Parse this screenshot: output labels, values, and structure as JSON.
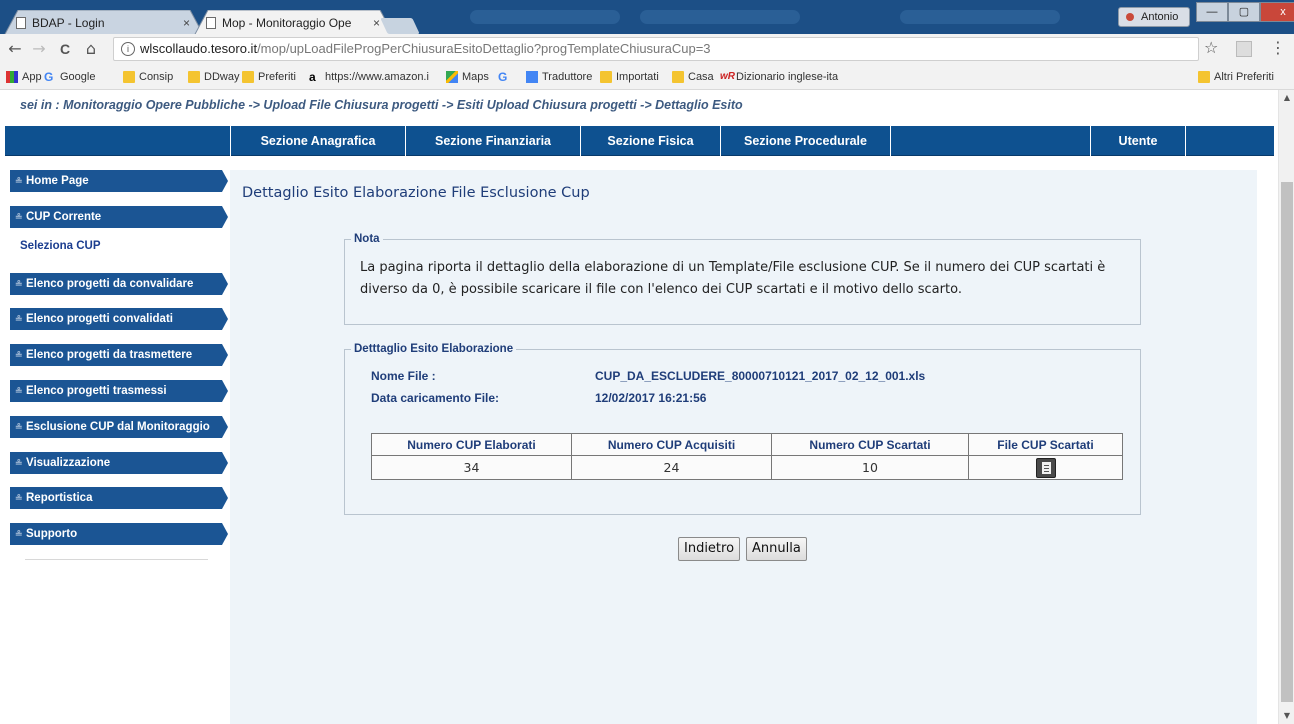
{
  "browser": {
    "tabs": [
      {
        "label": "BDAP - Login",
        "close": "×"
      },
      {
        "label": "Mop - Monitoraggio Ope",
        "close": "×"
      }
    ],
    "user": "Antonio",
    "window_buttons": {
      "minimize": "—",
      "maximize": "▢",
      "close": "x"
    },
    "url_host": "wlscollaudo.tesoro.it",
    "url_path": "/mop/upLoadFileProgPerChiusuraEsitoDettaglio?progTemplateChiusuraCup=3",
    "nav": {
      "back": "←",
      "forward": "→",
      "reload": "C",
      "home": "⌂",
      "info": "i",
      "star": "☆",
      "menu": "⋮"
    },
    "bookmarks": [
      {
        "label": "App",
        "icon": "apps-icon"
      },
      {
        "label": "Google",
        "icon": "google-icon"
      },
      {
        "label": "Consip",
        "icon": "folder-icon"
      },
      {
        "label": "DDway",
        "icon": "folder-icon"
      },
      {
        "label": "Preferiti",
        "icon": "folder-icon"
      },
      {
        "label": "https://www.amazon.i",
        "icon": "amazon-icon"
      },
      {
        "label": "Maps",
        "icon": "maps-icon"
      },
      {
        "label": "",
        "icon": "google-icon"
      },
      {
        "label": "Traduttore",
        "icon": "translate-icon"
      },
      {
        "label": "Importati",
        "icon": "folder-icon"
      },
      {
        "label": "Casa",
        "icon": "folder-icon"
      },
      {
        "label": "Dizionario inglese-ita",
        "icon": "wordreference-icon"
      }
    ],
    "other_bookmarks": "Altri Preferiti"
  },
  "page": {
    "breadcrumb": "sei in : Monitoraggio Opere Pubbliche -> Upload File Chiusura progetti -> Esiti Upload Chiusura progetti -> Dettaglio Esito",
    "main_nav": [
      "Sezione Anagrafica",
      "Sezione Finanziaria",
      "Sezione Fisica",
      "Sezione Procedurale",
      "",
      "Utente"
    ],
    "sidebar": [
      {
        "label": "Home Page",
        "type": "item"
      },
      {
        "label": "CUP Corrente",
        "type": "item"
      },
      {
        "label": "Seleziona CUP",
        "type": "link"
      },
      {
        "label": "Elenco progetti da convalidare",
        "type": "item"
      },
      {
        "label": "Elenco progetti convalidati",
        "type": "item"
      },
      {
        "label": "Elenco progetti da trasmettere",
        "type": "item"
      },
      {
        "label": "Elenco progetti trasmessi",
        "type": "item"
      },
      {
        "label": "Esclusione CUP dal Monitoraggio",
        "type": "item"
      },
      {
        "label": "Visualizzazione",
        "type": "item"
      },
      {
        "label": "Reportistica",
        "type": "item"
      },
      {
        "label": "Supporto",
        "type": "item"
      }
    ],
    "sidebar_bullet": "≗",
    "title": "Dettaglio Esito Elaborazione File Esclusione Cup",
    "nota": {
      "legend": "Nota",
      "text": "La pagina riporta il dettaglio della elaborazione di un Template/File esclusione CUP. Se il numero dei CUP scartati è diverso da 0, è possibile scaricare il file con l'elenco dei CUP scartati e il motivo dello scarto."
    },
    "dettaglio": {
      "legend": "Detttaglio Esito Elaborazione",
      "nome_file_label": "Nome File :",
      "nome_file_value": "CUP_DA_ESCLUDERE_80000710121_2017_02_12_001.xls",
      "data_label": "Data caricamento File:",
      "data_value": "12/02/2017 16:21:56",
      "table": {
        "headers": [
          "Numero CUP Elaborati",
          "Numero CUP Acquisiti",
          "Numero CUP Scartati",
          "File CUP Scartati"
        ],
        "row": [
          "34",
          "24",
          "10"
        ]
      }
    },
    "buttons": {
      "back": "Indietro",
      "cancel": "Annulla"
    }
  },
  "colors": {
    "nav_bg": "#0e5190",
    "sidebar_item_bg": "#1b5594",
    "content_bg": "#eef4f9",
    "title_text": "#1f3d79",
    "breadcrumb_text": "#3d5a80"
  }
}
